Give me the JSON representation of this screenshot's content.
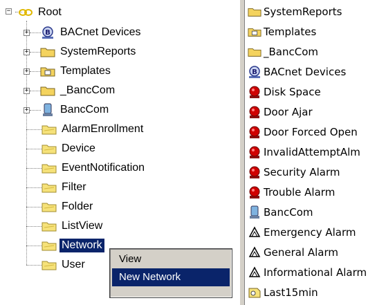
{
  "tree": {
    "root": {
      "label": "Root",
      "expander": "−",
      "icon": "root-icon"
    },
    "items": [
      {
        "label": "BACnet Devices",
        "icon": "bacnet-icon",
        "expander": "+"
      },
      {
        "label": "SystemReports",
        "icon": "folder-icon",
        "expander": "+"
      },
      {
        "label": "Templates",
        "icon": "template-folder-icon",
        "expander": "+"
      },
      {
        "label": "_BancCom",
        "icon": "folder-icon",
        "expander": "+"
      },
      {
        "label": "BancCom",
        "icon": "computer-icon",
        "expander": "+"
      },
      {
        "label": "AlarmEnrollment",
        "icon": "yellow-folder-icon"
      },
      {
        "label": "Device",
        "icon": "yellow-folder-icon"
      },
      {
        "label": "EventNotification",
        "icon": "yellow-folder-icon"
      },
      {
        "label": "Filter",
        "icon": "yellow-folder-icon"
      },
      {
        "label": "Folder",
        "icon": "yellow-folder-icon"
      },
      {
        "label": "ListView",
        "icon": "yellow-folder-icon"
      },
      {
        "label": "Network",
        "icon": "yellow-folder-icon",
        "selected": true
      },
      {
        "label": "User",
        "icon": "yellow-folder-icon"
      }
    ]
  },
  "context_menu": {
    "items": [
      {
        "label": "View"
      },
      {
        "label": "New Network",
        "highlighted": true
      }
    ]
  },
  "list": {
    "items": [
      {
        "label": "SystemReports",
        "icon": "folder-icon"
      },
      {
        "label": "Templates",
        "icon": "template-folder-icon"
      },
      {
        "label": "_BancCom",
        "icon": "folder-icon"
      },
      {
        "label": "BACnet Devices",
        "icon": "bacnet-icon"
      },
      {
        "label": "Disk Space",
        "icon": "alarm-red-icon"
      },
      {
        "label": "Door Ajar",
        "icon": "alarm-red-icon"
      },
      {
        "label": "Door Forced Open",
        "icon": "alarm-red-icon"
      },
      {
        "label": "InvalidAttemptAlm",
        "icon": "alarm-red-icon"
      },
      {
        "label": "Security Alarm",
        "icon": "alarm-red-icon"
      },
      {
        "label": "Trouble Alarm",
        "icon": "alarm-red-icon"
      },
      {
        "label": "BancCom",
        "icon": "computer-icon"
      },
      {
        "label": "Emergency Alarm",
        "icon": "warning-icon"
      },
      {
        "label": "General Alarm",
        "icon": "warning-icon"
      },
      {
        "label": "Informational Alarm",
        "icon": "warning-icon"
      },
      {
        "label": "Last15min",
        "icon": "report-icon"
      }
    ]
  },
  "colors": {
    "selection": "#0a246a",
    "folder": "#f4d35e",
    "alarm": "#d00000"
  }
}
